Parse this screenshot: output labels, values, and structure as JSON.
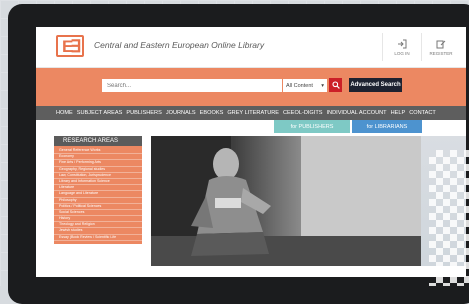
{
  "site": {
    "logo": "E∃",
    "title": "Central and Eastern European Online Library",
    "actions": [
      {
        "label": "LOG IN",
        "icon": "login-icon"
      },
      {
        "label": "REGISTER",
        "icon": "register-icon"
      }
    ]
  },
  "search": {
    "placeholder": "Search...",
    "scope": "All Content",
    "advanced_label": "Advanced Search"
  },
  "nav": {
    "items": [
      "HOME",
      "SUBJECT AREAS",
      "PUBLISHERS",
      "JOURNALS",
      "EBOOKS",
      "GREY LITERATURE",
      "CEEOL-DIGITS",
      "INDIVIDUAL ACCOUNT",
      "HELP",
      "CONTACT"
    ]
  },
  "subtabs": {
    "publishers": "for PUBLISHERS",
    "librarians": "for LIBRARIANS"
  },
  "research": {
    "heading": "RESEARCH AREAS",
    "items": [
      "General Reference Works",
      "Economy",
      "Fine Arts / Performing Arts",
      "Geography, Regional studies",
      "Law, Constitution, Jurisprudence",
      "Library and Information Science",
      "Literature",
      "Language and Literature",
      "Philosophy",
      "Politics / Political Sciences",
      "Social Sciences",
      "History",
      "Theology and Religion",
      "Jewish studies",
      "Essay (Book Review / Scientific Life"
    ]
  },
  "colors": {
    "accent": "#ec8862",
    "navbar": "#5e5e5e",
    "search_button": "#cc1f27",
    "advanced_button": "#1d2230",
    "publishers_tab": "#7ec9c5",
    "librarians_tab": "#4d93cf"
  }
}
